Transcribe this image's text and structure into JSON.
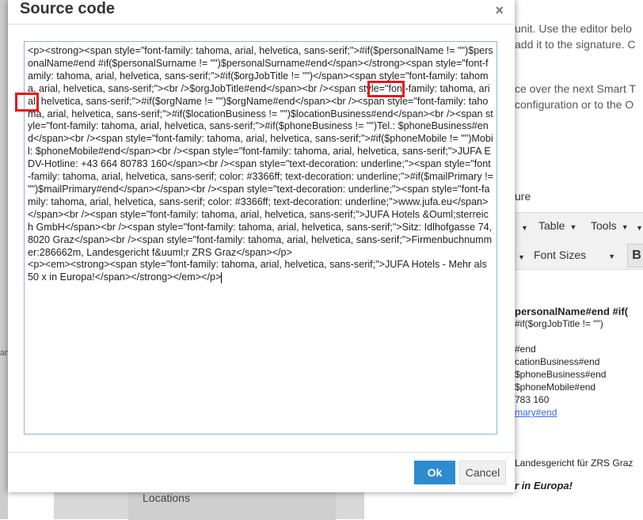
{
  "background": {
    "right_lines": [
      "unit. Use the editor belo",
      "add it to the signature. C",
      "ce over the next Smart T",
      "configuration or to the O",
      "ure"
    ],
    "toolbar": {
      "table_label": "Table",
      "tools_label": "Tools",
      "font_sizes_label": "Font Sizes",
      "bold_label": "B"
    },
    "signature_lines": [
      "personalName#end #if(",
      "#if($orgJobTitle != \"\")",
      "#end",
      "cationBusiness#end",
      " $phoneBusiness#end",
      "$phoneMobile#end",
      "783 160",
      "mary#end",
      "Landesgericht für ZRS Graz",
      "r in Europa!"
    ],
    "left_edge_text": "ar",
    "sidebar_item": "Locations"
  },
  "dialog": {
    "title": "Source code",
    "close_label": "×",
    "source_code": "<p><strong><span style=\"font-family: tahoma, arial, helvetica, sans-serif;\">#if($personalName != \"\")$personalName#end #if($personalSurname != \"\")$personalSurname#end</span></strong><span style=\"font-family: tahoma, arial, helvetica, sans-serif;\">#if($orgJobTitle != \"\")</span><span style=\"font-family: tahoma, arial, helvetica, sans-serif;\"><br />$orgJobTitle#end</span><br /><span style=\"font-family: tahoma, arial, helvetica, sans-serif;\">#if($orgName != \"\")$orgName#end</span><br /><span style=\"font-family: tahoma, arial, helvetica, sans-serif;\">#if($locationBusiness != \"\")$locationBusiness#end</span><br /><span style=\"font-family: tahoma, arial, helvetica, sans-serif;\">#if($phoneBusiness != \"\")Tel.: $phoneBusiness#end</span><br /><span style=\"font-family: tahoma, arial, helvetica, sans-serif;\">#if($phoneMobile != \"\")Mobil: $phoneMobile#end</span><br /><span style=\"font-family: tahoma, arial, helvetica, sans-serif;\">JUFA EDV-Hotline: +43 664 80783 160</span><br /><span style=\"text-decoration: underline;\"><span style=\"font-family: tahoma, arial, helvetica, sans-serif; color: #3366ff; text-decoration: underline;\">#if($mailPrimary != \"\")$mailPrimary#end</span></span><br /><span style=\"text-decoration: underline;\"><span style=\"font-family: tahoma, arial, helvetica, sans-serif; color: #3366ff; text-decoration: underline;\">www.jufa.eu</span></span><br /><span style=\"font-family: tahoma, arial, helvetica, sans-serif;\">JUFA Hotels &Ouml;sterreich GmbH</span><br /><span style=\"font-family: tahoma, arial, helvetica, sans-serif;\">Sitz: Idlhofgasse 74, 8020 Graz</span><br /><span style=\"font-family: tahoma, arial, helvetica, sans-serif;\">Firmenbuchnummer:286662m, Landesgericht f&uuml;r ZRS Graz</span></p>\n<p><em><strong><span style=\"font-family: tahoma, arial, helvetica, sans-serif;\">JUFA Hotels - Mehr als 50 x in Europa!</span></strong></em></p>",
    "ok_label": "Ok",
    "cancel_label": "Cancel"
  },
  "highlight_color": "#e8141b",
  "accent_color": "#2e8bd0"
}
